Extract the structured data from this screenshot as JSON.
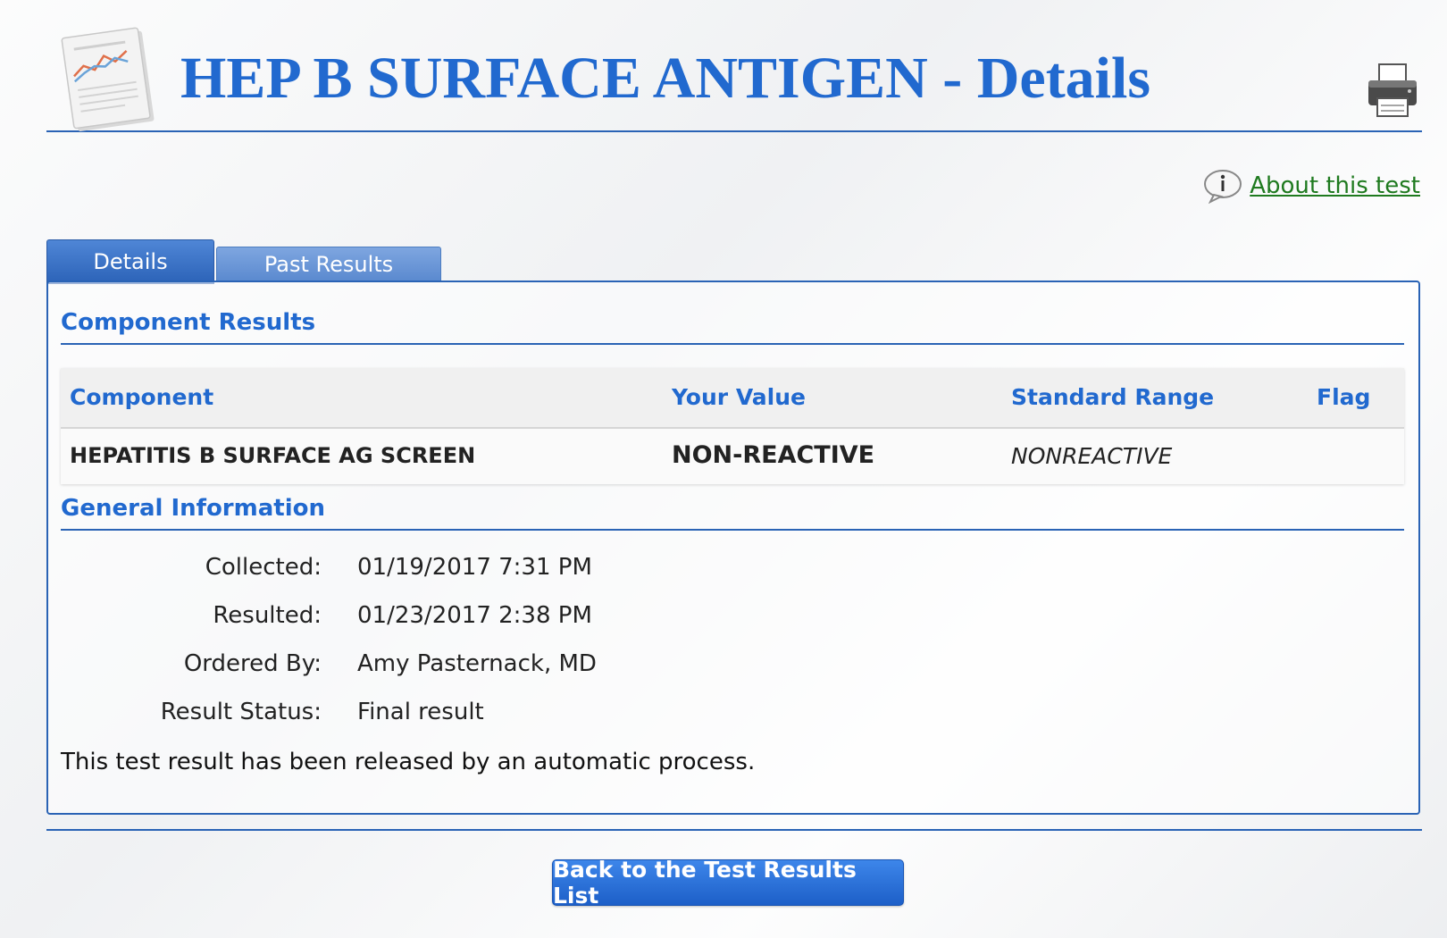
{
  "header": {
    "title": "HEP B SURFACE ANTIGEN - Details",
    "about_link": "About this test"
  },
  "tabs": [
    {
      "label": "Details",
      "active": true
    },
    {
      "label": "Past Results",
      "active": false
    }
  ],
  "component_results": {
    "title": "Component Results",
    "columns": [
      "Component",
      "Your Value",
      "Standard Range",
      "Flag"
    ],
    "rows": [
      {
        "component": "HEPATITIS B SURFACE AG SCREEN",
        "value": "NON-REACTIVE",
        "range": "NONREACTIVE",
        "flag": ""
      }
    ]
  },
  "general_information": {
    "title": "General Information",
    "fields": [
      {
        "label": "Collected:",
        "value": "01/19/2017 7:31 PM"
      },
      {
        "label": "Resulted:",
        "value": "01/23/2017 2:38 PM"
      },
      {
        "label": "Ordered By:",
        "value": "Amy Pasternack, MD"
      },
      {
        "label": "Result Status:",
        "value": "Final result"
      }
    ],
    "note": "This test result has been released by an automatic process."
  },
  "footer": {
    "back_button": "Back to the Test Results List"
  },
  "colors": {
    "accent": "#2169cf",
    "link_green": "#1f7a1f",
    "rule": "#2a63b5"
  },
  "icons": {
    "document": "chart-document-icon",
    "printer": "printer-icon",
    "info": "info-icon"
  }
}
